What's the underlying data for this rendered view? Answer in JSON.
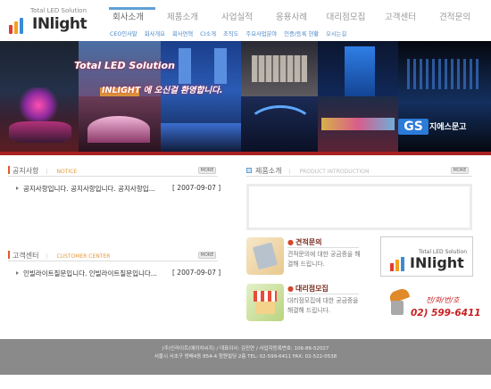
{
  "brand": {
    "tagline": "Total LED Solution",
    "name": "INlight"
  },
  "nav": {
    "items": [
      "회사소개",
      "제품소개",
      "사업실적",
      "응용사례",
      "대리점모집",
      "고객센터",
      "견적문의"
    ],
    "sub_items": [
      "CEO인사말",
      "회사개요",
      "회사연혁",
      "CI소개",
      "조직도",
      "주요사업분야",
      "인증/등록 현황",
      "오시는길"
    ]
  },
  "banner": {
    "headline": "Total LED Solution",
    "slogan": "INLIGHT 에 오신걸 환영합니다.",
    "sign_logo": "GS",
    "sign_text": "지에스문고"
  },
  "notice": {
    "title": "공지사항",
    "subtitle": "NOTICE",
    "more": "MORE",
    "items": [
      {
        "text": "공지사항입니다. 공지사항입니다. 공지사항입...",
        "date": "[ 2007-09-07 ]"
      }
    ]
  },
  "customer": {
    "title": "고객센터",
    "subtitle": "CUSTOMER CENTER",
    "more": "MORE",
    "items": [
      {
        "text": "인빌라이트질문입니다. 인빌라이트질문입니다...",
        "date": "[ 2007-09-07 ]"
      }
    ]
  },
  "product": {
    "title": "제품소개",
    "subtitle": "PRODUCT INTRODUCTION",
    "more": "MORE"
  },
  "estimate": {
    "title": "견적문의",
    "text": "견적문의에 대한 궁금증을 해결해 드립니다."
  },
  "dealer": {
    "title": "대리점모집",
    "text": "대리점모집에 대한 궁금증을 해결해 드립니다."
  },
  "contact": {
    "label": "전/화/번/호",
    "phone": "02) 599-6411"
  },
  "footer": {
    "line1": "(주)인라이트(에이치씨지) / 대표이사: 김진연 / 사업자등록번호: 106-86-52027",
    "line2": "서울시 서초구 방배4동 854-4 청원빌딩 2층  TEL: 02-599-6411  FAX: 02-522-0538"
  },
  "colors": {
    "accent_blue": "#5fa0d6",
    "accent_red": "#a82020",
    "footer_gray": "#8a8a8a"
  }
}
